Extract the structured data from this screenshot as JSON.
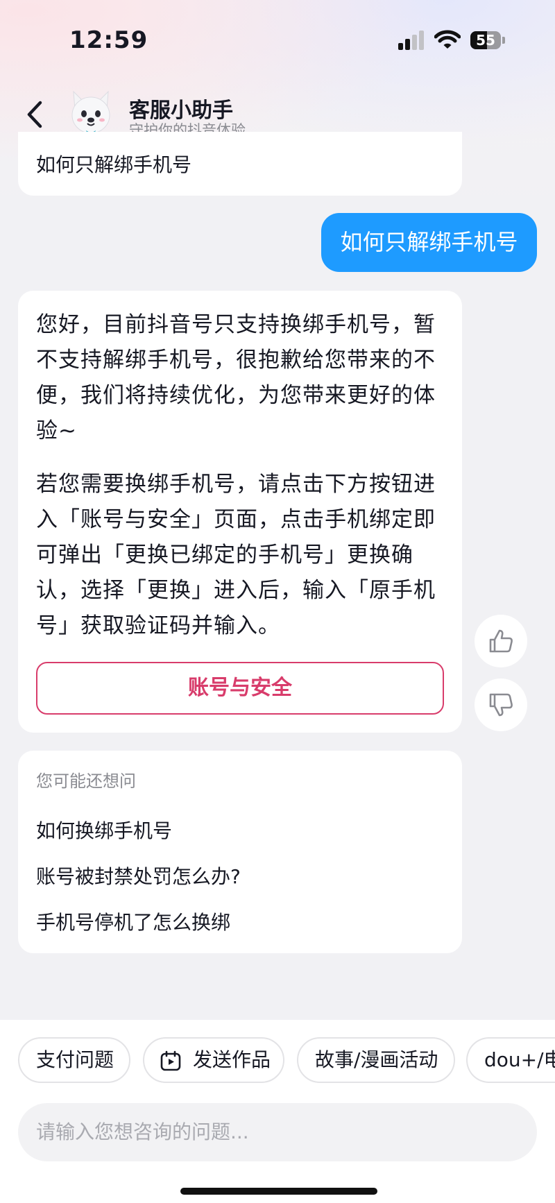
{
  "status_bar": {
    "time": "12:59",
    "battery_level": "55",
    "battery_percent": 55
  },
  "header": {
    "title": "客服小助手",
    "subtitle": "守护你的抖音体验",
    "avatar_icon": "white-puppy-mascot-icon"
  },
  "chat": {
    "prev_bot_text": "如何只解绑手机号",
    "user_message": "如何只解绑手机号",
    "answer": {
      "paragraph1": "您好，目前抖音号只支持换绑手机号，暂不支持解绑手机号，很抱歉给您带来的不便，我们将持续优化，为您带来更好的体验~",
      "paragraph2": "若您需要换绑手机号，请点击下方按钮进入「账号与安全」页面，点击手机绑定即可弹出「更换已绑定的手机号」更换确认，选择「更换」进入后，输入「原手机号」获取验证码并输入。",
      "button_label": "账号与安全",
      "accent_color": "#d83c6b"
    },
    "feedback": {
      "like_icon": "thumbs-up-icon",
      "dislike_icon": "thumbs-down-icon"
    },
    "suggestions": {
      "title": "您可能还想问",
      "items": [
        "如何换绑手机号",
        "账号被封禁处罚怎么办?",
        "手机号停机了怎么换绑"
      ]
    }
  },
  "quick_chips": [
    "支付问题",
    "发送作品",
    "故事/漫画活动",
    "dou+/电"
  ],
  "input": {
    "placeholder": "请输入您想咨询的问题..."
  },
  "colors": {
    "user_bubble": "#1e9bff",
    "background": "#f1f1f4"
  }
}
